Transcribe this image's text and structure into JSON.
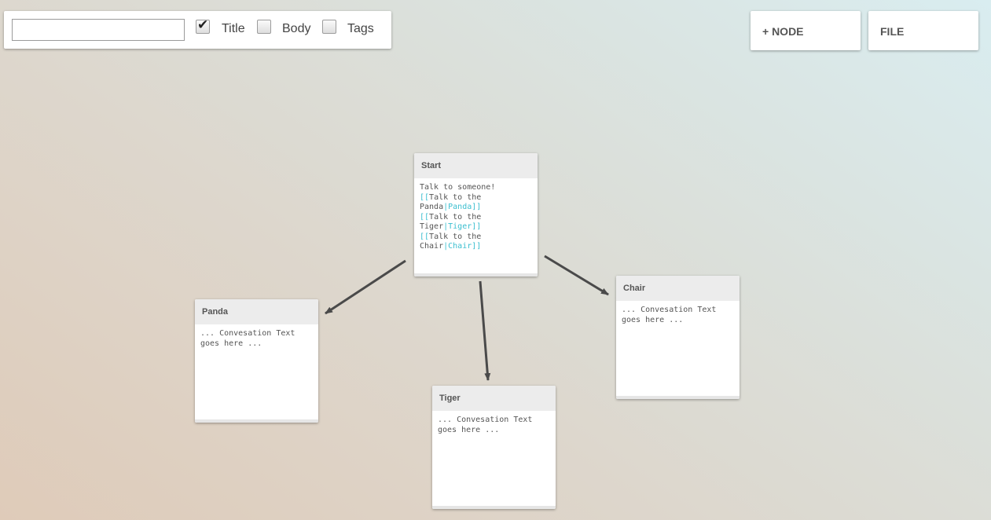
{
  "search": {
    "value": "",
    "placeholder": "",
    "filters": [
      {
        "label": "Title",
        "checked": true
      },
      {
        "label": "Body",
        "checked": false
      },
      {
        "label": "Tags",
        "checked": false
      }
    ]
  },
  "toolbar": {
    "add_node_label": "+ NODE",
    "file_label": "FILE"
  },
  "nodes": {
    "start": {
      "title": "Start",
      "intro": "Talk to someone!",
      "links": [
        {
          "open": "[[",
          "text": "Talk to the Panda",
          "sep": "|",
          "target": "Panda",
          "close": "]]"
        },
        {
          "open": "[[",
          "text": "Talk to the Tiger",
          "sep": "|",
          "target": "Tiger",
          "close": "]]"
        },
        {
          "open": "[[",
          "text": "Talk to the Chair",
          "sep": "|",
          "target": "Chair",
          "close": "]]"
        }
      ]
    },
    "panda": {
      "title": "Panda",
      "body": "... Convesation Text goes here ..."
    },
    "tiger": {
      "title": "Tiger",
      "body": "... Convesation Text goes here ..."
    },
    "chair": {
      "title": "Chair",
      "body": "... Convesation Text goes here ..."
    }
  },
  "colors": {
    "link": "#3bbfd0",
    "arrow": "#4a4a4a"
  }
}
